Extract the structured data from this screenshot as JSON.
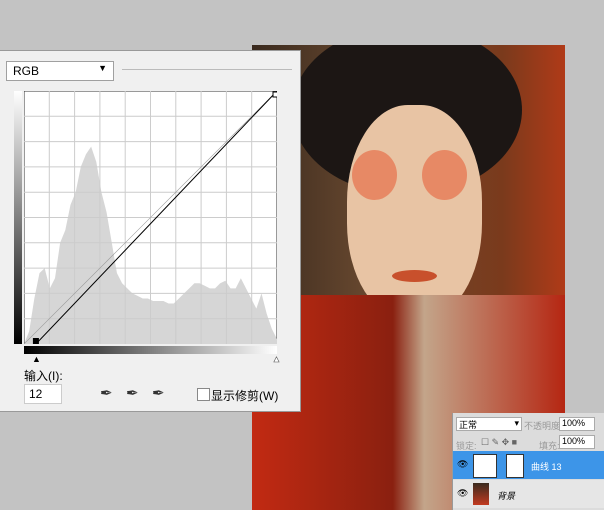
{
  "curves": {
    "channel": "RGB",
    "input_label": "输入(I):",
    "input_value": "12",
    "show_clipping_label": "显示修剪(W)",
    "show_clipping_checked": false,
    "histogram": [
      0,
      5,
      18,
      28,
      30,
      22,
      26,
      40,
      45,
      55,
      60,
      70,
      75,
      78,
      72,
      60,
      52,
      40,
      28,
      24,
      22,
      20,
      19,
      18,
      18,
      17,
      17,
      17,
      16,
      16,
      18,
      20,
      22,
      24,
      24,
      23,
      22,
      22,
      24,
      25,
      22,
      22,
      26,
      22,
      18,
      14,
      20,
      12,
      6,
      2
    ]
  },
  "layers": {
    "blend_mode": "正常",
    "opacity_label": "不透明度:",
    "opacity": "100%",
    "lock_label": "锁定:",
    "fill_label": "填充:",
    "fill": "100%",
    "items": [
      {
        "name": "曲线 13",
        "selected": true
      },
      {
        "name": "背景",
        "selected": false
      }
    ]
  },
  "colors": {
    "selection": "#3d95e8"
  }
}
